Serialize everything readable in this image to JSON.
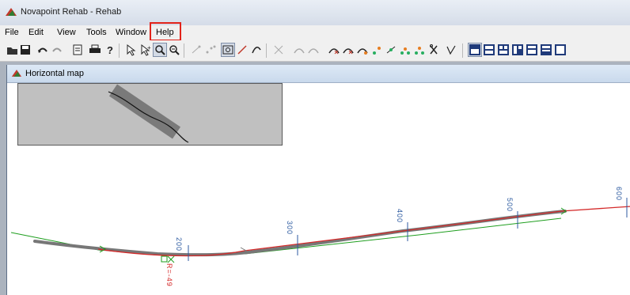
{
  "window": {
    "title": "Novapoint Rehab - Rehab",
    "app_icon": "novapoint-app-icon"
  },
  "menu": {
    "items": [
      "File",
      "Edit",
      "View",
      "Tools",
      "Window",
      "Help"
    ],
    "highlighted": "Help",
    "highlight_color": "#e2231a"
  },
  "toolbar": {
    "icons": [
      "open-folder-icon",
      "save-icon",
      "undo-icon",
      "redo-icon",
      "page-icon",
      "print-icon",
      "help-cursor-icon",
      "select-icon",
      "select-add-icon",
      "zoom-window-icon",
      "zoom-out-icon",
      "point-tool-icon",
      "multi-point-icon",
      "zoom-extents-icon",
      "line-tool-icon",
      "arc-tool-icon",
      "erase-node-icon",
      "curve-left-icon",
      "curve-right-icon",
      "delete-curve-icon",
      "delete-curve-2-icon",
      "insert-node-icon",
      "move-node-icon",
      "add-node-icon",
      "add-node-2-icon",
      "cut-icon",
      "measure-icon",
      "layout-1-icon",
      "layout-2-icon",
      "layout-3-icon",
      "layout-4-icon",
      "layout-5-icon",
      "layout-6-icon"
    ],
    "pressed": "zoom-window-icon"
  },
  "child_window": {
    "title": "Horizontal map",
    "icon": "map-window-icon"
  },
  "map": {
    "stations": [
      "200",
      "300",
      "400",
      "500",
      "600"
    ],
    "curve_label": "R=-49",
    "colors": {
      "alignment_red": "#d42a2a",
      "reference_green": "#1e9e1e",
      "station_blue": "#2c5aa0",
      "road_gray": "#777777"
    }
  }
}
